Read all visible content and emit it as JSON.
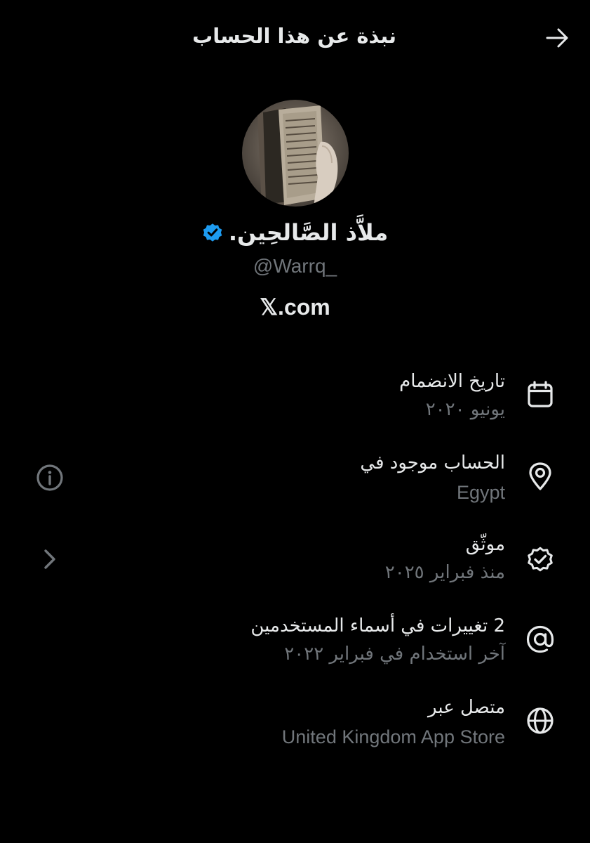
{
  "header": {
    "title": "نبذة عن هذا الحساب"
  },
  "profile": {
    "display_name": "ملاَّذ الصَّالحِين.",
    "handle": "@Warrq_",
    "brand": "𝕏.com"
  },
  "rows": [
    {
      "title": "تاريخ الانضمام",
      "subtitle": "يونيو ٢٠٢٠",
      "icon": "calendar-icon"
    },
    {
      "title": "الحساب موجود في",
      "subtitle": "Egypt",
      "icon": "location-pin-icon"
    },
    {
      "title": "موثّق",
      "subtitle": "منذ فبراير ٢٠٢٥",
      "icon": "verified-check-icon"
    },
    {
      "title": "2 تغييرات في أسماء المستخدمين",
      "subtitle": "آخر استخدام في فبراير ٢٠٢٢",
      "icon": "at-sign-icon"
    },
    {
      "title": "متصل عبر",
      "subtitle": "United Kingdom App Store",
      "icon": "globe-icon"
    }
  ],
  "colors": {
    "background": "#000000",
    "text_primary": "#e7e9ea",
    "text_secondary": "#71767b",
    "verified_blue": "#1d9bf0"
  }
}
